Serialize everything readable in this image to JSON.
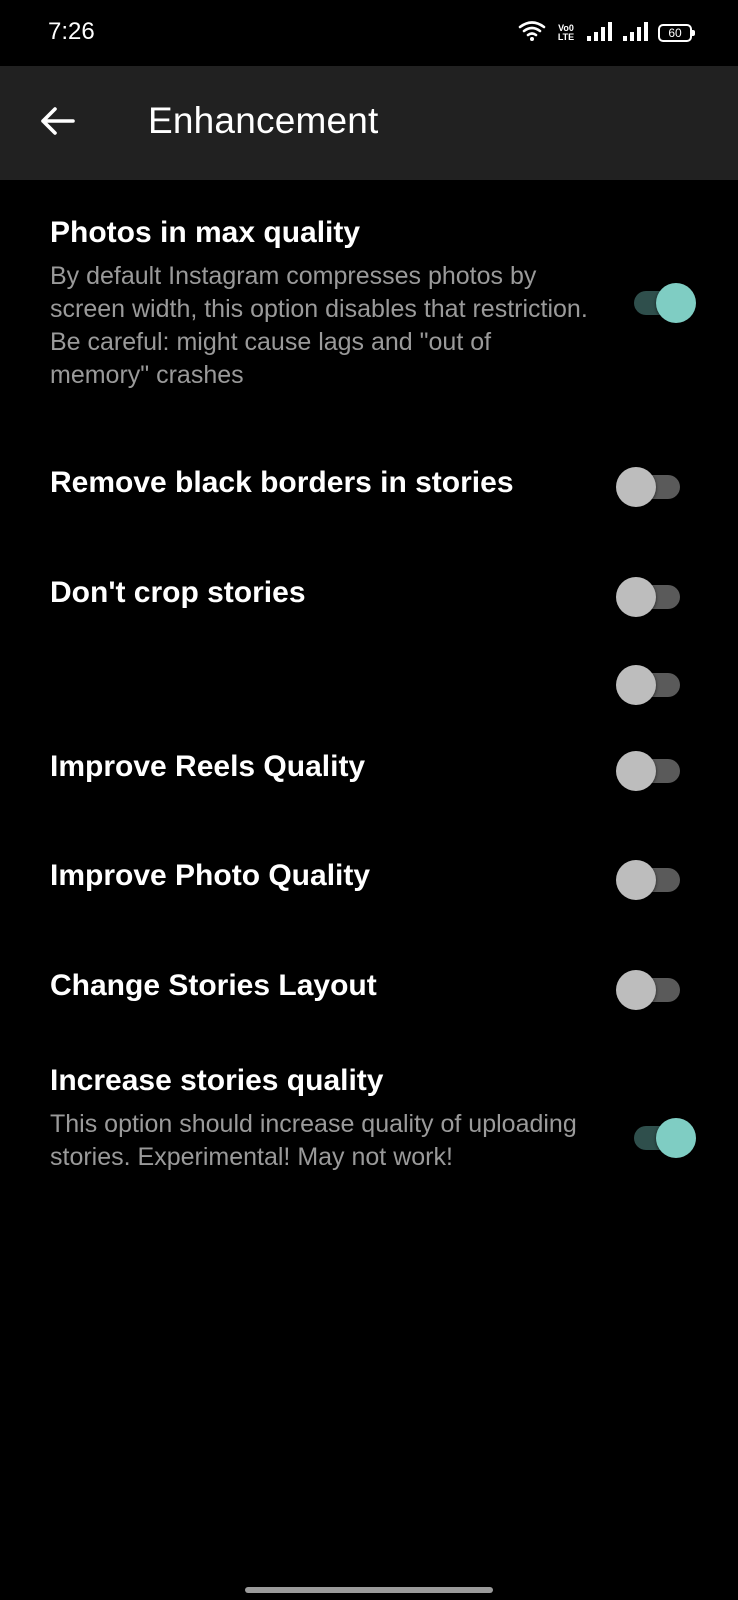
{
  "status_bar": {
    "time": "7:26",
    "volte_line1": "Vo0",
    "volte_line2": "LTE",
    "battery": "60"
  },
  "app_bar": {
    "title": "Enhancement",
    "back_icon": "arrow-left-icon"
  },
  "settings": [
    {
      "title": "Photos in max quality",
      "description": "By default Instagram compresses photos by screen width, this option disables that restriction. Be careful: might cause lags and \"out of memory\" crashes",
      "enabled": true
    },
    {
      "title": "Remove black borders in stories",
      "enabled": false
    },
    {
      "title": "Don't crop stories",
      "enabled": false
    },
    {
      "title": "",
      "enabled": false
    },
    {
      "title": "Improve Reels Quality",
      "enabled": false
    },
    {
      "title": "Improve Photo Quality",
      "enabled": false
    },
    {
      "title": "Change Stories Layout",
      "enabled": false
    },
    {
      "title": "Increase stories quality",
      "description": "This option should increase quality of uploading stories. Experimental! May not work!",
      "enabled": true
    }
  ],
  "colors": {
    "background": "#000000",
    "app_bar": "#212121",
    "switch_on_thumb": "#7fcdc3",
    "switch_on_track": "#2f4f4c",
    "switch_off_thumb": "#bdbdbd",
    "switch_off_track": "#5a5a5a",
    "description_text": "#9a9a9a"
  }
}
